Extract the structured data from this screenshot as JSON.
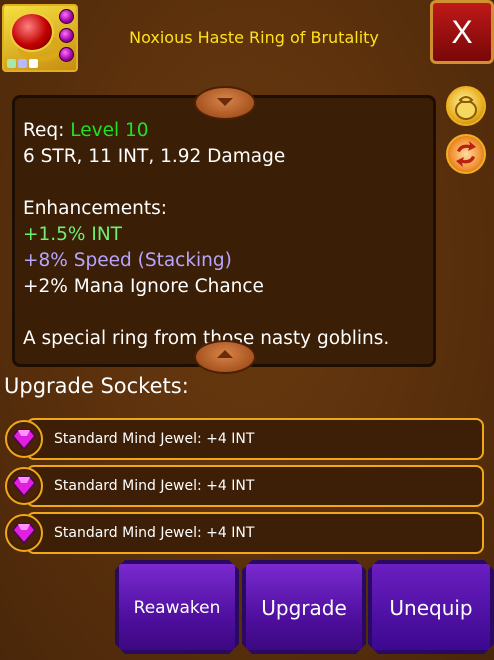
{
  "item": {
    "name": "Noxious Haste Ring of Brutality",
    "colors": {
      "title": "#ffe21a",
      "level": "#22e022",
      "int_bonus": "#6ef06e",
      "speed_bonus": "#b6a6ff",
      "normal": "#ffffff"
    }
  },
  "close_button": {
    "label": "X"
  },
  "description": {
    "req_prefix": "Req: ",
    "req_level": "Level 10",
    "stats": "6 STR, 11 INT, 1.92 Damage",
    "enhancements_label": "Enhancements:",
    "enhancements": [
      {
        "text": "+1.5% INT",
        "color": "#6ef06e"
      },
      {
        "text": "+8% Speed (Stacking)",
        "color": "#b6a6ff"
      },
      {
        "text": "+2% Mana Ignore Chance",
        "color": "#ffffff"
      }
    ],
    "flavor": "A special ring from those nasty goblins."
  },
  "side_icons": [
    "gold-bag-icon",
    "swap-icon"
  ],
  "sockets": {
    "label": "Upgrade Sockets:",
    "items": [
      {
        "text": "Standard Mind Jewel: +4 INT",
        "icon": "purple-gem-icon"
      },
      {
        "text": "Standard Mind Jewel: +4 INT",
        "icon": "purple-gem-icon"
      },
      {
        "text": "Standard Mind Jewel: +4 INT",
        "icon": "purple-gem-icon"
      }
    ]
  },
  "actions": {
    "reawaken": "Reawaken",
    "upgrade": "Upgrade",
    "unequip": "Unequip"
  }
}
